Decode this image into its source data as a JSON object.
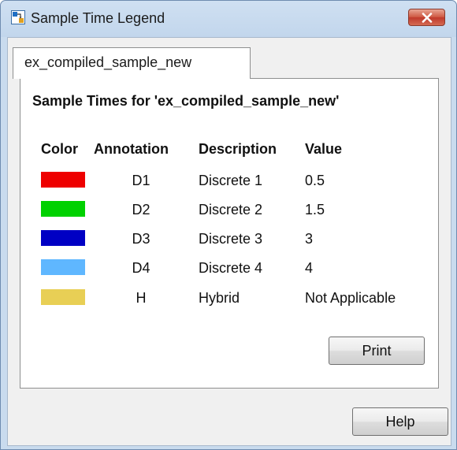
{
  "window": {
    "title": "Sample Time Legend",
    "app_icon": "simulink-model-icon",
    "close_icon": "close-icon"
  },
  "tab": {
    "label": "ex_compiled_sample_new"
  },
  "panel": {
    "heading": "Sample Times for 'ex_compiled_sample_new'",
    "columns": [
      "Color",
      "Annotation",
      "Description",
      "Value"
    ],
    "rows": [
      {
        "color": "#ee0000",
        "annotation": "D1",
        "description": "Discrete 1",
        "value": "0.5"
      },
      {
        "color": "#00d100",
        "annotation": "D2",
        "description": "Discrete 2",
        "value": "1.5"
      },
      {
        "color": "#0000c4",
        "annotation": "D3",
        "description": "Discrete 3",
        "value": "3"
      },
      {
        "color": "#5fb7ff",
        "annotation": "D4",
        "description": "Discrete 4",
        "value": "4"
      },
      {
        "color": "#e8cf55",
        "annotation": "H",
        "description": "Hybrid",
        "value": "Not Applicable"
      }
    ]
  },
  "buttons": {
    "print_label": "Print",
    "help_label": "Help"
  }
}
